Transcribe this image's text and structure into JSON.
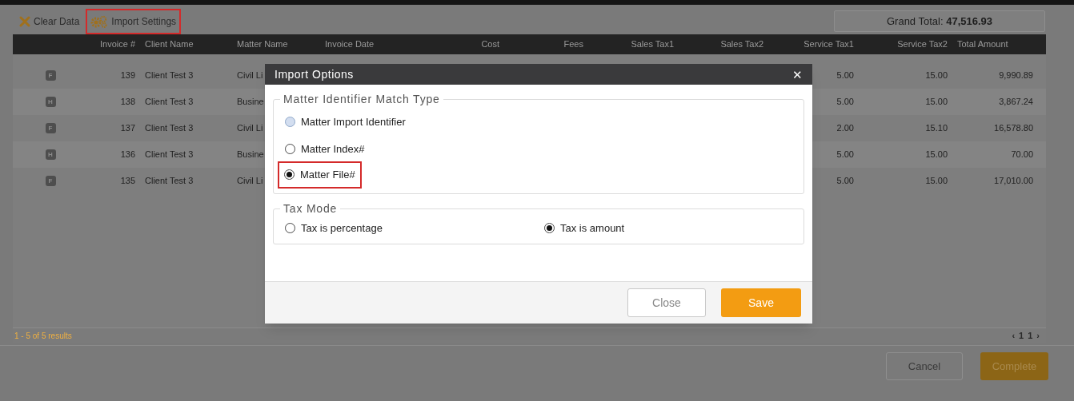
{
  "toolbar": [
    {
      "kind": "clear",
      "label": "Clear Data",
      "highlighted": false
    },
    {
      "kind": "settings",
      "label": "Import Settings",
      "highlighted": true
    }
  ],
  "grand_total": {
    "label": "Grand Total:",
    "value": "47,516.93"
  },
  "table": {
    "columns": [
      "Invoice #",
      "Client Name",
      "Matter Name",
      "Invoice Date",
      "Cost",
      "Fees",
      "Sales Tax1",
      "Sales Tax2",
      "Service Tax1",
      "Service Tax2",
      "Total Amount"
    ],
    "rows": [
      {
        "badge": "F",
        "invoice": "139",
        "client": "Client Test 3",
        "matter": "Civil Li",
        "service_tax1": "5.00",
        "service_tax2": "15.00",
        "total": "9,990.89"
      },
      {
        "badge": "H",
        "invoice": "138",
        "client": "Client Test 3",
        "matter": "Busine",
        "service_tax1": "5.00",
        "service_tax2": "15.00",
        "total": "3,867.24"
      },
      {
        "badge": "F",
        "invoice": "137",
        "client": "Client Test 3",
        "matter": "Civil Li",
        "service_tax1": "2.00",
        "service_tax2": "15.10",
        "total": "16,578.80"
      },
      {
        "badge": "H",
        "invoice": "136",
        "client": "Client Test 3",
        "matter": "Busine",
        "service_tax1": "5.00",
        "service_tax2": "15.00",
        "total": "70.00"
      },
      {
        "badge": "F",
        "invoice": "135",
        "client": "Client Test 3",
        "matter": "Civil Li",
        "service_tax1": "5.00",
        "service_tax2": "15.00",
        "total": "17,010.00"
      }
    ]
  },
  "results": "1 - 5 of 5 results",
  "pager": [
    "‹",
    "1",
    "1",
    "›"
  ],
  "buttons": [
    {
      "kind": "secondary",
      "label": "Cancel"
    },
    {
      "kind": "primary",
      "label": "Complete"
    }
  ],
  "dialog": {
    "title": "Import Options",
    "close": "✕",
    "groups": [
      {
        "legend": "Matter Identifier Match Type",
        "kind": "list",
        "options": [
          {
            "label": "Matter Import Identifier",
            "selected": false,
            "focused": true,
            "highlighted": false
          },
          {
            "label": "Matter Index#",
            "selected": false,
            "focused": false,
            "highlighted": false
          },
          {
            "label": "Matter File#",
            "selected": true,
            "focused": false,
            "highlighted": true
          }
        ]
      },
      {
        "legend": "Tax Mode",
        "kind": "inline",
        "options": [
          {
            "label": "Tax is percentage",
            "selected": false,
            "focused": false,
            "highlighted": false
          },
          {
            "label": "Tax is amount",
            "selected": true,
            "focused": false,
            "highlighted": false
          }
        ]
      }
    ],
    "buttons": [
      {
        "kind": "secondary",
        "label": "Close"
      },
      {
        "kind": "primary",
        "label": "Save"
      }
    ]
  }
}
